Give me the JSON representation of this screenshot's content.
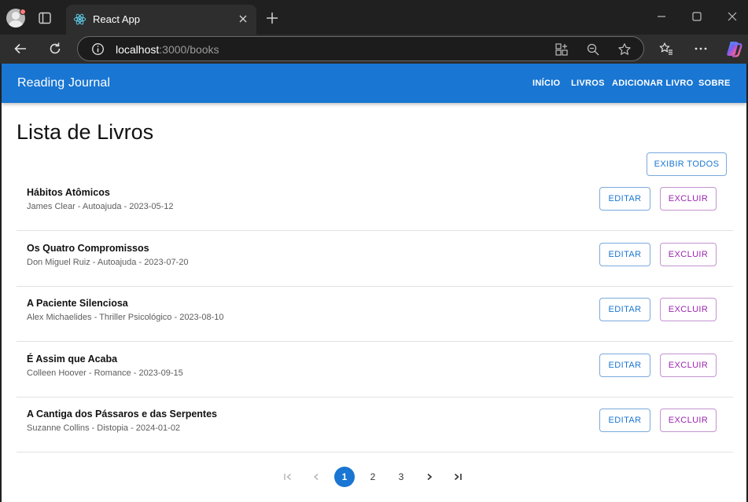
{
  "browser": {
    "tab_title": "React App",
    "url_host": "localhost",
    "url_path": ":3000/books",
    "colors": {
      "chrome_bg": "#202020",
      "toolbar_bg": "#2e2e2e"
    }
  },
  "app": {
    "brand": "Reading Journal",
    "nav": [
      {
        "label": "INÍCIO"
      },
      {
        "label": "LIVROS"
      },
      {
        "label": "ADICIONAR LIVRO"
      },
      {
        "label": "SOBRE"
      }
    ],
    "colors": {
      "primary": "#1976d2",
      "secondary": "#9c27b0"
    }
  },
  "main": {
    "title": "Lista de Livros",
    "show_all_label": "EXIBIR TODOS",
    "books": [
      {
        "title": "Hábitos Atômicos",
        "meta": "James Clear - Autoajuda - 2023-05-12",
        "edit_label": "EDITAR",
        "delete_label": "EXCLUIR"
      },
      {
        "title": "Os Quatro Compromissos",
        "meta": "Don Miguel Ruiz - Autoajuda - 2023-07-20",
        "edit_label": "EDITAR",
        "delete_label": "EXCLUIR"
      },
      {
        "title": "A Paciente Silenciosa",
        "meta": "Alex Michaelides - Thriller Psicológico - 2023-08-10",
        "edit_label": "EDITAR",
        "delete_label": "EXCLUIR"
      },
      {
        "title": "É Assim que Acaba",
        "meta": "Colleen Hoover - Romance - 2023-09-15",
        "edit_label": "EDITAR",
        "delete_label": "EXCLUIR"
      },
      {
        "title": "A Cantiga dos Pássaros e das Serpentes",
        "meta": "Suzanne Collins - Distopia - 2024-01-02",
        "edit_label": "EDITAR",
        "delete_label": "EXCLUIR"
      }
    ]
  },
  "pagination": {
    "pages": [
      "1",
      "2",
      "3"
    ],
    "current_page": "1",
    "icons": [
      "first-page-icon",
      "previous-page-icon",
      "next-page-icon",
      "last-page-icon"
    ]
  }
}
